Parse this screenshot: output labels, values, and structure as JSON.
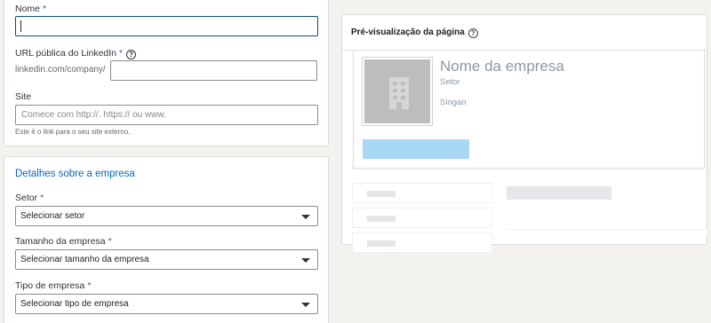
{
  "form": {
    "name": {
      "label": "Nome",
      "required": "*",
      "value": ""
    },
    "linkedin_url": {
      "label": "URL pública do LinkedIn",
      "required": "*",
      "help_icon": "question-icon",
      "prefix": "linkedin.com/company/",
      "value": ""
    },
    "site": {
      "label": "Site",
      "placeholder": "Comece com http://. https:// ou www.",
      "helper": "Este é o link para o seu site externo."
    }
  },
  "details": {
    "title": "Detalhes sobre a empresa",
    "sector": {
      "label": "Setor",
      "required": "*",
      "selected": "Selecionar setor"
    },
    "size": {
      "label": "Tamanho da empresa",
      "required": "*",
      "selected": "Selecionar tamanho da empresa"
    },
    "type": {
      "label": "Tipo de empresa",
      "required": "*",
      "selected": "Selecionar tipo de empresa"
    }
  },
  "preview": {
    "title": "Pré-visualização da página",
    "help_icon": "question-icon",
    "logo_icon": "building-icon",
    "company_name": "Nome da empresa",
    "sector": "Setor",
    "slogan": "Slogan"
  },
  "colors": {
    "accent": "#0a66c2",
    "follow_placeholder": "#a8d8f5",
    "logo_bg": "#bdbdbd"
  }
}
